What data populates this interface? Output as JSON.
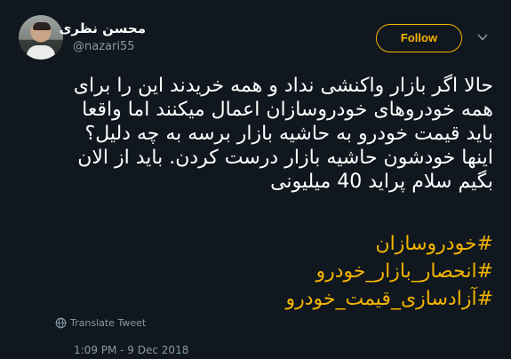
{
  "author": {
    "display_name": "محسن نظری",
    "handle": "@nazari55"
  },
  "follow_button": {
    "label": "Follow"
  },
  "tweet": {
    "lines": [
      "حالا اگر بازار واکنشی نداد و همه خریدند این را برای",
      "همه خودروهای خودروسازان اعمال میکنند اما واقعا",
      "باید قیمت خودرو به حاشیه بازار برسه به چه دلیل؟",
      "اینها خودشون حاشیه بازار درست کردن. باید از الان",
      "بگیم سلام پراید 40 میلیونی"
    ],
    "hashtags": [
      "#خودروسازان",
      "#انحصار_بازار_خودرو",
      "#آزادسازی_قیمت_خودرو"
    ]
  },
  "translate": {
    "label": "Translate Tweet"
  },
  "meta": {
    "timestamp": "1:09 PM - 9 Dec 2018"
  },
  "colors": {
    "background": "#10171e",
    "accent": "#f4b400",
    "text": "#ffffff",
    "secondary": "#8899a6"
  },
  "icons": {
    "more": "chevron-down-icon",
    "translate": "globe-icon"
  }
}
